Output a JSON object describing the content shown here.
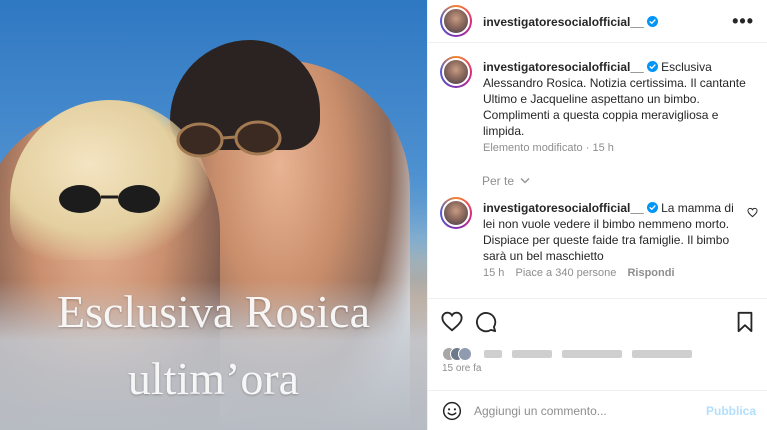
{
  "post": {
    "image": {
      "overlay_line_1": "Esclusiva Rosica",
      "overlay_line_2": "ultim’ora"
    },
    "header": {
      "username": "investigatoresocialofficial__",
      "verified": true,
      "more_label": "•••"
    },
    "caption": {
      "username": "investigatoresocialofficial__",
      "text": "Esclusiva Alessandro Rosica. Notizia certissima. Il cantante Ultimo e Jacqueline aspettano un bimbo. Complimenti a questa coppia meravigliosa e limpida.",
      "edited_label": "Elemento modificato",
      "time": "15 h"
    },
    "for_you_label": "Per te",
    "comment": {
      "username": "investigatoresocialofficial__",
      "text": "La mamma di lei non vuole vedere il bimbo nemmeno morto. Dispiace per queste faide tra famiglie. Il bimbo sarà un bel maschietto",
      "time": "15 h",
      "likes": "Piace a 340 persone",
      "reply_label": "Rispondi"
    },
    "time_ago": "15 ore fa",
    "add_comment": {
      "placeholder": "Aggiungi un commento...",
      "publish_label": "Pubblica"
    },
    "colors": {
      "verified_blue": "#0095f6",
      "publish_disabled": "#b2dffc",
      "secondary_text": "#8e8e8e"
    }
  }
}
